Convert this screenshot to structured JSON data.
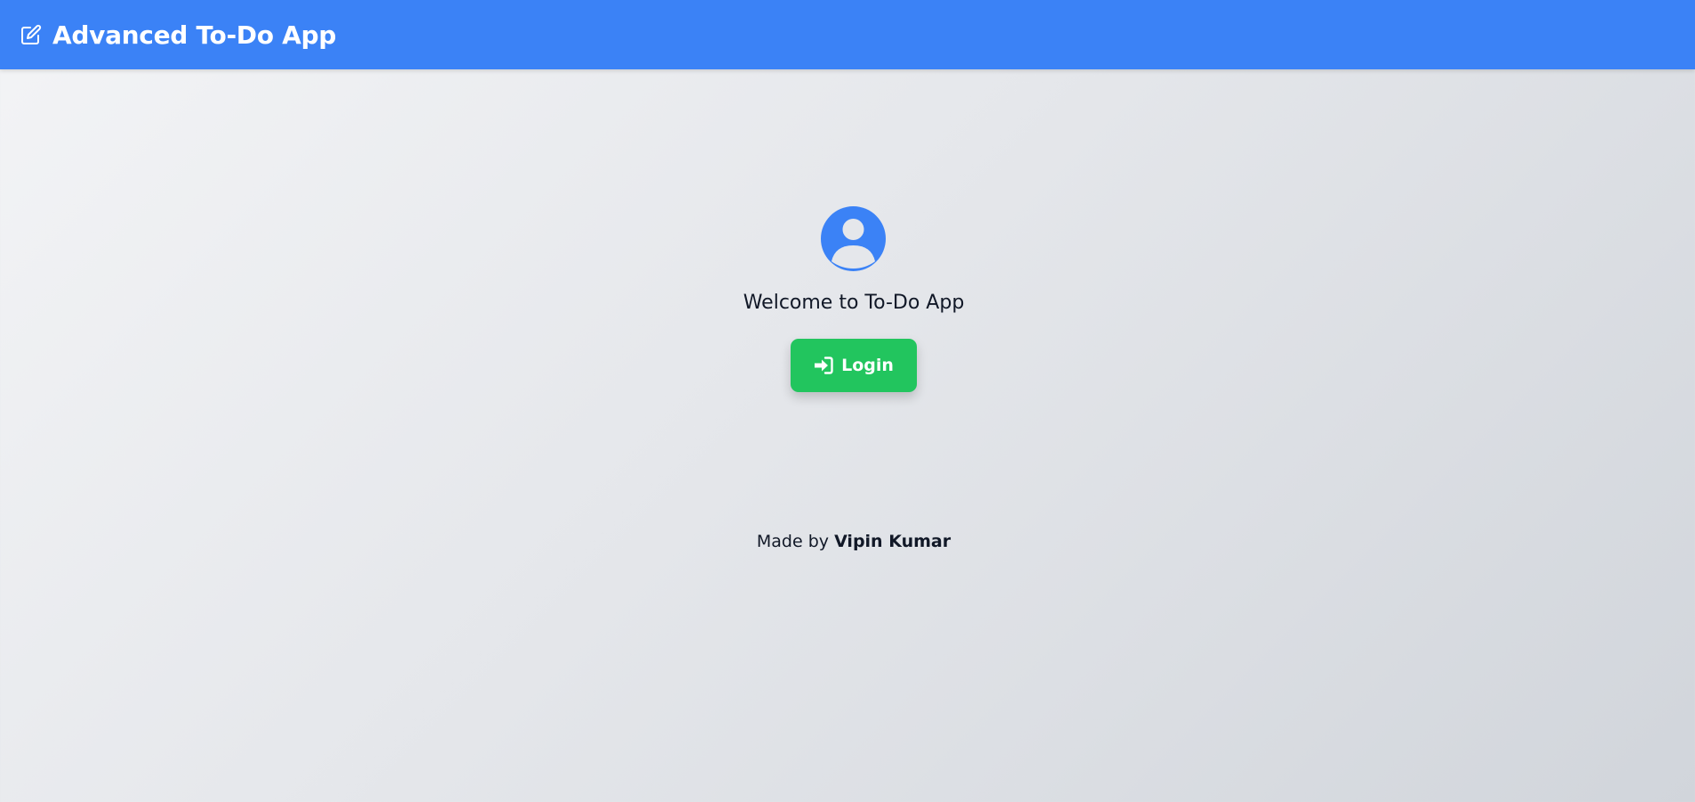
{
  "header": {
    "logo_icon": "edit-square-icon",
    "title": "Advanced To-Do App",
    "background_color": "#3b82f6"
  },
  "main": {
    "avatar_icon": "user-circle-icon",
    "welcome_text": "Welcome to To-Do App",
    "login_button": {
      "icon": "sign-in-icon",
      "label": "Login",
      "color": "#22c55e"
    }
  },
  "footer": {
    "prefix": "Made by",
    "author": "Vipin Kumar"
  }
}
